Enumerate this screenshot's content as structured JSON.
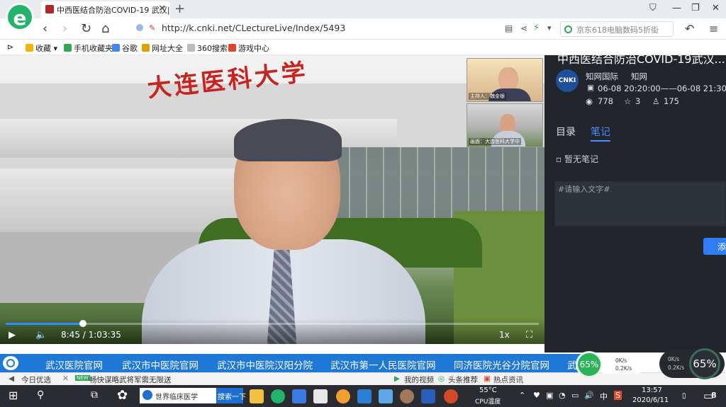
{
  "browser": {
    "tab_title": "中西医结合防治COVID-19 武汉|",
    "url": "http://k.cnki.net/CLectureLive/Index/5493",
    "search_placeholder": "京东618电脑数码5折街",
    "bookmarks": [
      "收藏",
      "手机收藏夹",
      "谷歌",
      "网址大全",
      "360搜索",
      "游戏中心"
    ]
  },
  "video": {
    "sign_text": "大连医科大学",
    "thumb1_label": "主持人：魏金银",
    "thumb2_label": "画面：大连医科大学中",
    "progress_fraction": 0.145,
    "current_time": "8:45",
    "total_time": "1:03:35",
    "speed": "1x"
  },
  "panel": {
    "title": "中西医结合防治COVID-19武汉...",
    "org": "知网国际",
    "org2": "知网",
    "time": "06-08 20:20:00——06-08 21:30:0",
    "views": "778",
    "likes": "3",
    "users": "175",
    "tab_catalog": "目录",
    "tab_notes": "笔记",
    "notes_empty": "暂无笔记",
    "note_placeholder": "#请输入文字#",
    "save_label": "添"
  },
  "banner": {
    "links": [
      "武汉医院官网",
      "武汉市中医院官网",
      "武汉市中医院汉阳分院",
      "武汉市第一人民医院官网",
      "同济医院光谷分院官网",
      "武"
    ]
  },
  "statusbar": {
    "left": "今日优选",
    "news": "畅快谋略武将军需无限送",
    "right": [
      "我的视频",
      "头条推荐",
      "热点资讯"
    ]
  },
  "widgets": {
    "cpu_percent": "65%",
    "up_speed": "0K/s",
    "down_speed": "0.2K/s",
    "cpu2_percent": "65%"
  },
  "taskbar": {
    "search_text": "世界临床医学",
    "search_button": "搜索一下",
    "temperature": "55°C",
    "temp_label": "CPU温度",
    "ime": "中",
    "time": "13:57",
    "date": "2020/6/11",
    "notif_count": "8"
  }
}
